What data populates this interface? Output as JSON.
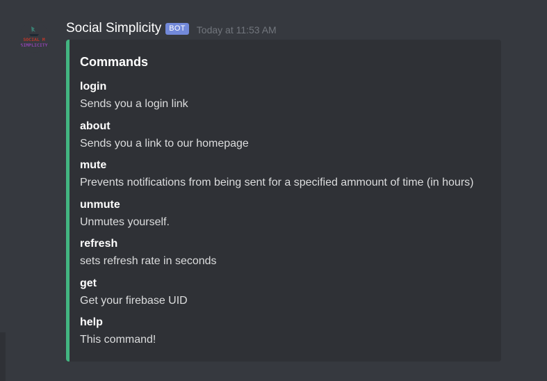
{
  "message": {
    "username": "Social Simplicity",
    "badge": "BOT",
    "timestamp": "Today at 11:53 AM",
    "avatar_text_line1": "SOCIAL M",
    "avatar_text_line2": "SIMPLICITY"
  },
  "embed": {
    "title": "Commands",
    "accent_color": "#43b581",
    "fields": [
      {
        "name": "login",
        "value": "Sends you a login link"
      },
      {
        "name": "about",
        "value": "Sends you a link to our homepage"
      },
      {
        "name": "mute",
        "value": "Prevents notifications from being sent for a specified ammount of time (in hours)"
      },
      {
        "name": "unmute",
        "value": "Unmutes yourself."
      },
      {
        "name": "refresh",
        "value": "sets refresh rate in seconds"
      },
      {
        "name": "get",
        "value": "Get your firebase UID"
      },
      {
        "name": "help",
        "value": "This command!"
      }
    ]
  }
}
